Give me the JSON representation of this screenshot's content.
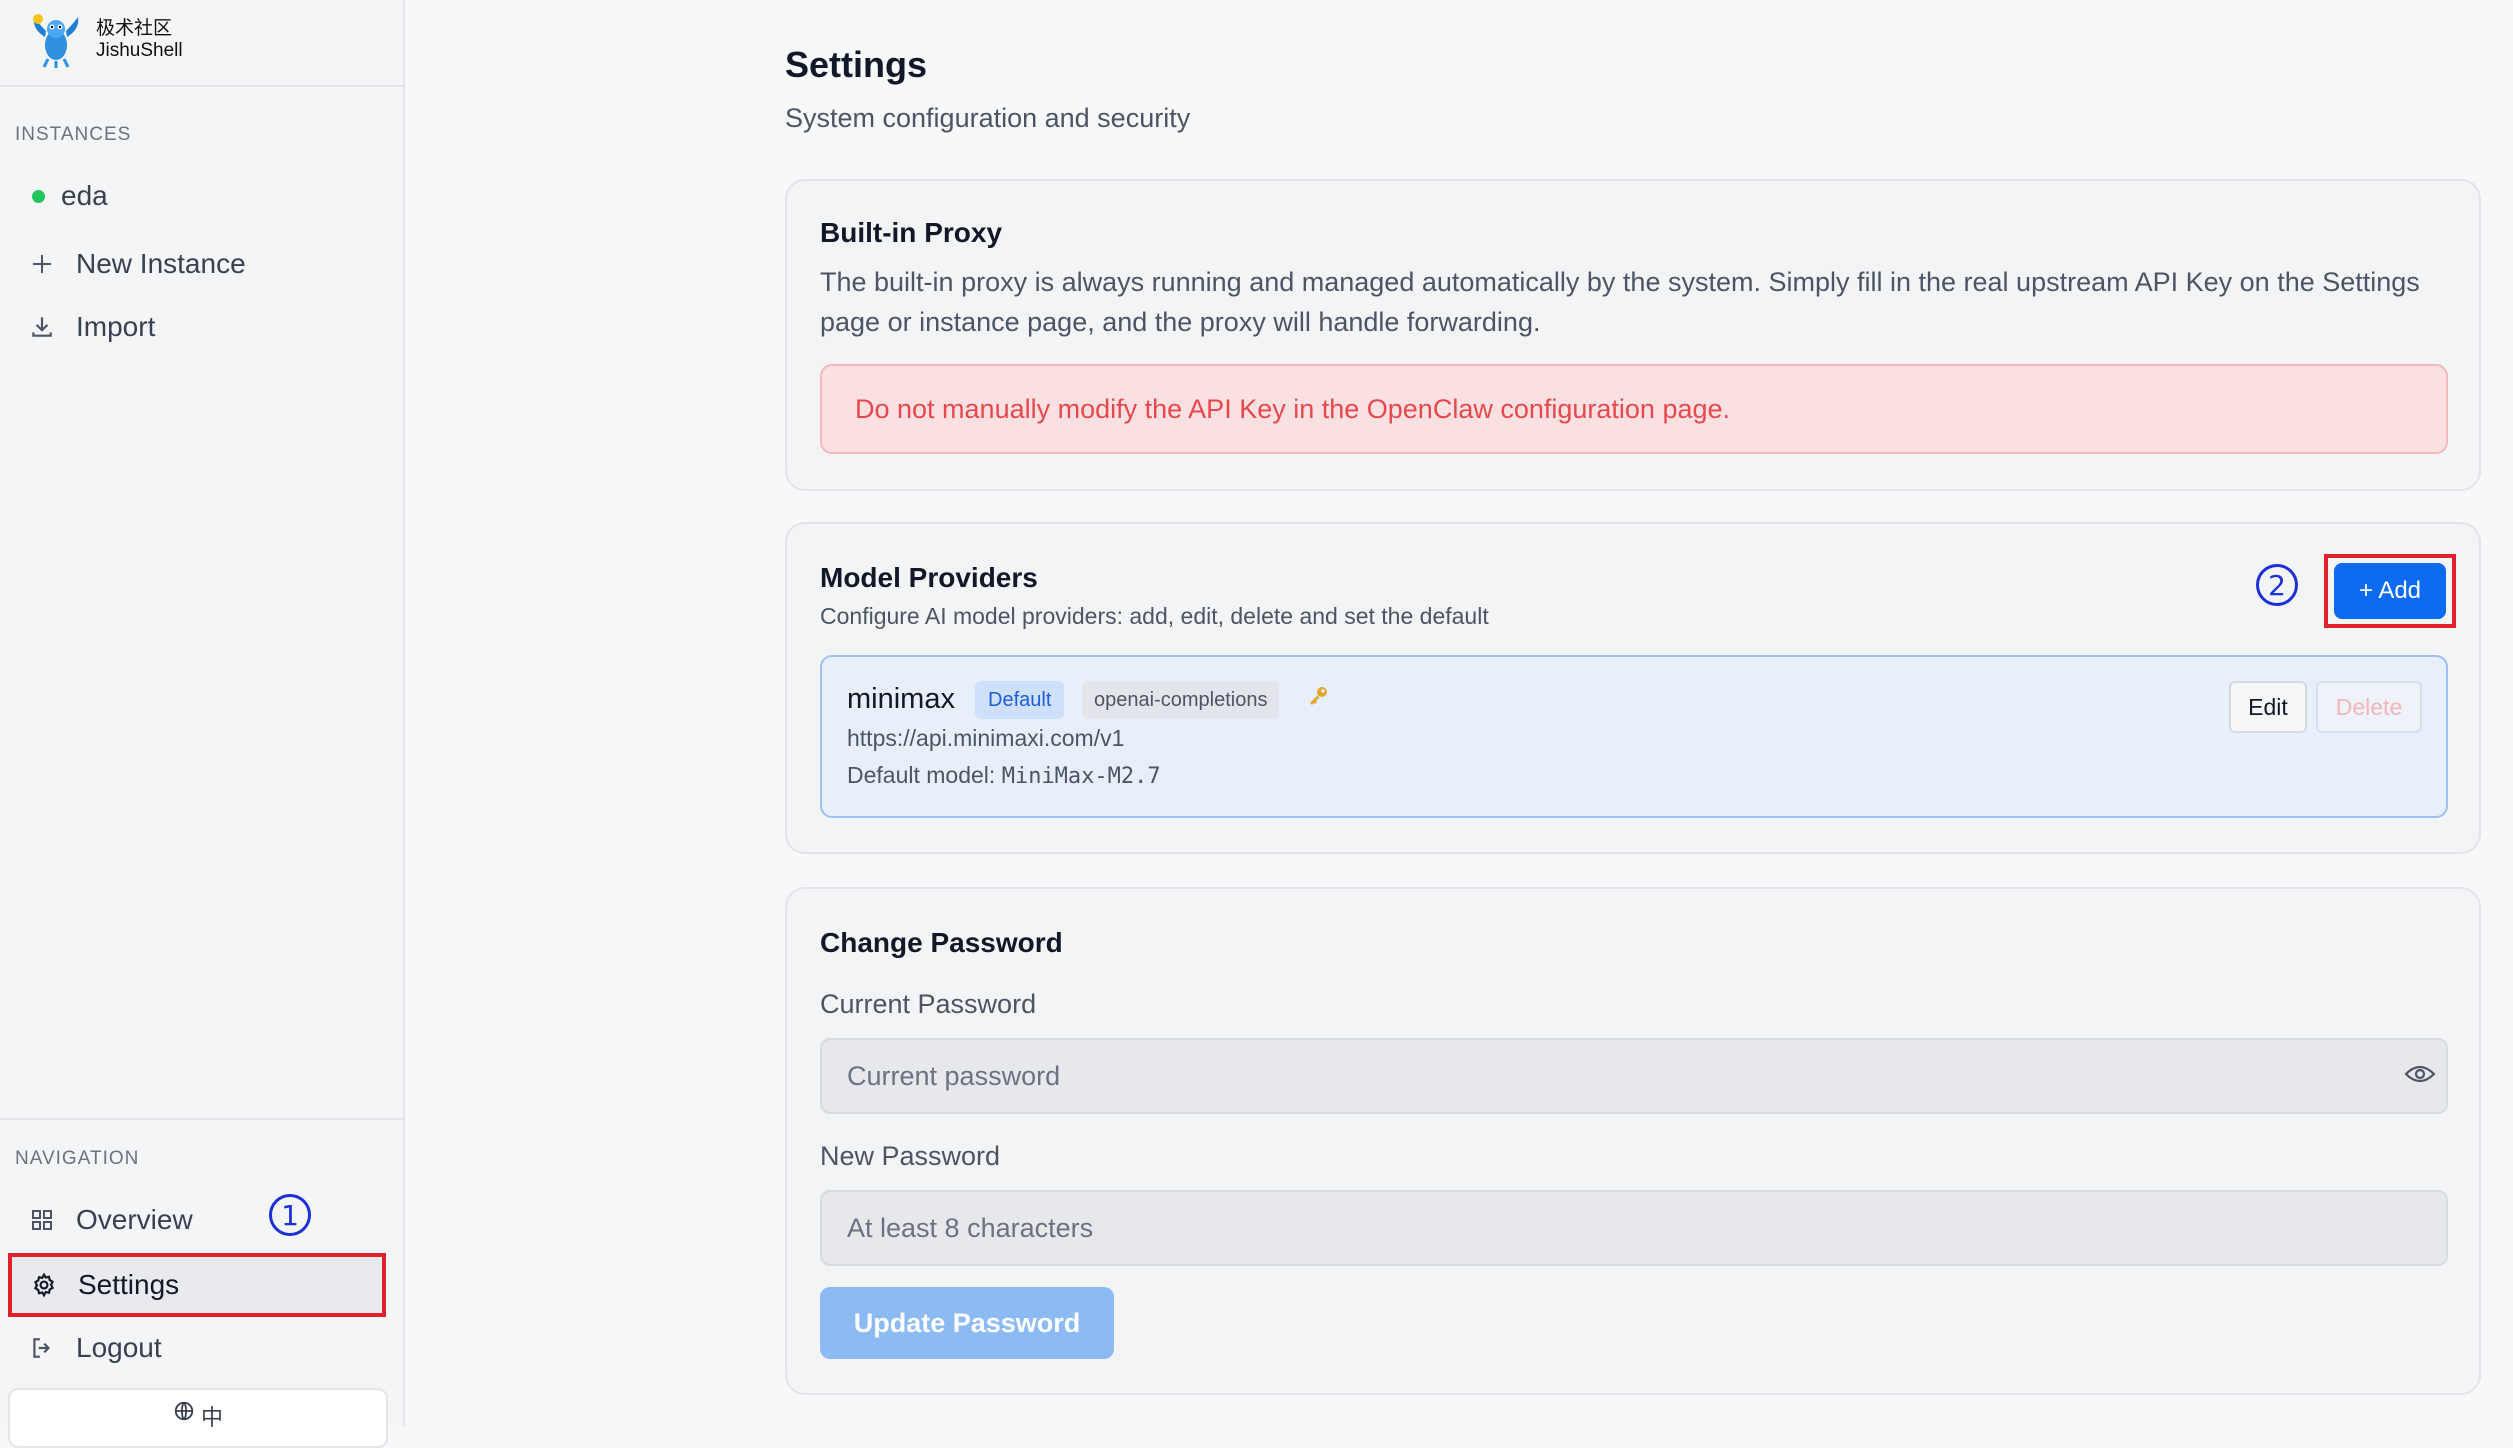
{
  "brand": {
    "name_cn": "极术社区",
    "name_en": "JishuShell"
  },
  "sidebar": {
    "instances_label": "INSTANCES",
    "instances": [
      {
        "name": "eda",
        "status_color": "#22c55e"
      }
    ],
    "new_instance": "New Instance",
    "import": "Import",
    "navigation_label": "NAVIGATION",
    "overview": "Overview",
    "settings": "Settings",
    "logout": "Logout",
    "language": "中"
  },
  "annotations": {
    "marker_1": "1",
    "marker_2": "2",
    "highlight_color": "#e0202a",
    "marker_color": "#1d2fd6"
  },
  "page": {
    "title": "Settings",
    "subtitle": "System configuration and security"
  },
  "proxy": {
    "title": "Built-in Proxy",
    "description": "The built-in proxy is always running and managed automatically by the system. Simply fill in the real upstream API Key on the Settings page or instance page, and the proxy will handle forwarding.",
    "warning": "Do not manually modify the API Key in the OpenClaw configuration page."
  },
  "providers": {
    "title": "Model Providers",
    "description": "Configure AI model providers: add, edit, delete and set the default",
    "add_label": "+ Add",
    "items": [
      {
        "name": "minimax",
        "default_badge": "Default",
        "type_badge": "openai-completions",
        "url": "https://api.minimaxi.com/v1",
        "default_model_label": "Default model:",
        "default_model": "MiniMax-M2.7",
        "edit_label": "Edit",
        "delete_label": "Delete"
      }
    ]
  },
  "password": {
    "title": "Change Password",
    "current_label": "Current Password",
    "current_placeholder": "Current password",
    "new_label": "New Password",
    "new_placeholder": "At least 8 characters",
    "update_label": "Update Password"
  },
  "colors": {
    "accent": "#0b6bf2",
    "danger": "#e5484d"
  }
}
